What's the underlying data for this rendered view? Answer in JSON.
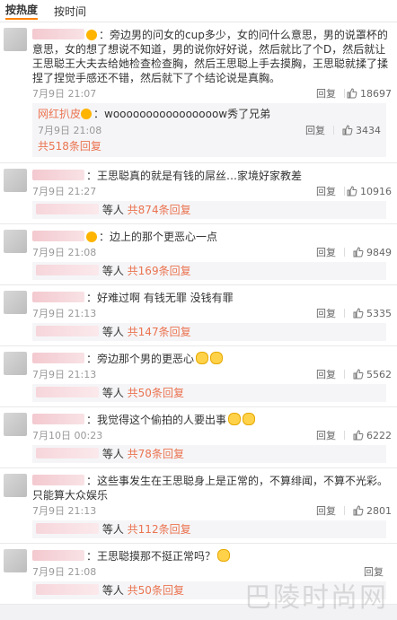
{
  "tabs": [
    "按热度",
    "按时间"
  ],
  "comments": [
    {
      "text": "：旁边男的问女的cup多少，女的问什么意思，男的说罩杯的意思，女的想了想说不知道，男的说你好好说，然后就比了个D，然后就让王思聪王大夫去给她检查检查胸，然后王思聪上手去摸胸，王思聪就揉了揉捏了捏觉手感还不错，然后就下了个结论说是真胸。",
      "time": "7月9日 21:07",
      "reply": "回复",
      "likes": "18697",
      "sub": {
        "nick": "网红扒皮",
        "text": "：woooooooooooooooow秀了兄弟",
        "time": "7月9日 21:08",
        "reply": "回复",
        "likes": "3434",
        "more": "共518条回复"
      }
    },
    {
      "text": "：王思聪真的就是有钱的屌丝…家境好家教差",
      "time": "7月9日 21:27",
      "reply": "回复",
      "likes": "10916",
      "more_prefix": "等人",
      "more": "共874条回复"
    },
    {
      "text": "：边上的那个更恶心一点",
      "time": "7月9日 21:08",
      "reply": "回复",
      "likes": "9849",
      "more_prefix": "等人",
      "more": "共169条回复"
    },
    {
      "text": "：好难过啊 有钱无罪 没钱有罪",
      "time": "7月9日 21:13",
      "reply": "回复",
      "likes": "5335",
      "more_prefix": "等人",
      "more": "共147条回复"
    },
    {
      "text": "：旁边那个男的更恶心",
      "time": "7月9日 21:13",
      "reply": "回复",
      "likes": "5562",
      "more_prefix": "等人",
      "more": "共50条回复"
    },
    {
      "text": "：我觉得这个偷拍的人要出事",
      "time": "7月10日 00:23",
      "reply": "回复",
      "likes": "6222",
      "more_prefix": "等人",
      "more": "共78条回复"
    },
    {
      "text": "：这些事发生在王思聪身上是正常的，不算绯闻，不算不光彩。只能算大众娱乐",
      "time": "7月9日 21:13",
      "reply": "回复",
      "likes": "2801",
      "more_prefix": "等人",
      "more": "共112条回复"
    },
    {
      "text": "：王思聪摸那不挺正常吗？",
      "time": "7月9日 21:08",
      "reply": "回复",
      "likes": "",
      "more_prefix": "等人",
      "more": "共50条回复"
    }
  ],
  "watermark": "巴陵时尚网"
}
